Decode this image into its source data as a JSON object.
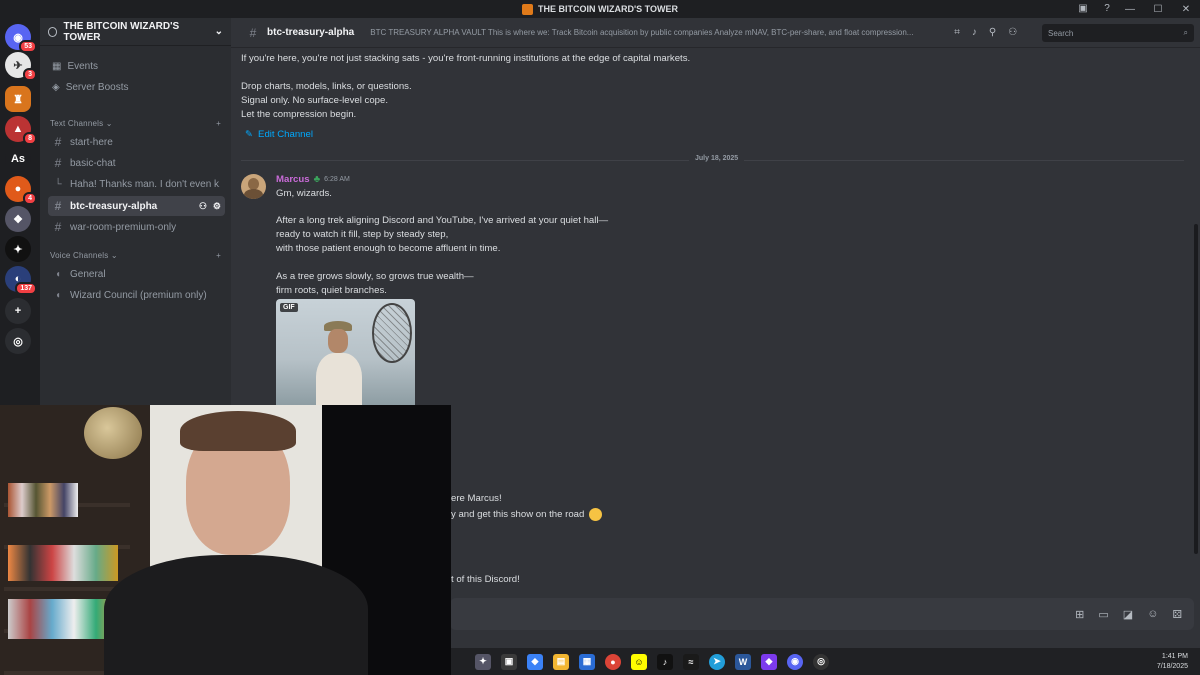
{
  "window": {
    "title": "THE BITCOIN WIZARD'S TOWER",
    "controls": [
      "—",
      "☐",
      "✕"
    ]
  },
  "servers": {
    "badges": [
      "53",
      "3",
      "8",
      "4",
      "137"
    ],
    "initials": "As"
  },
  "sidebar": {
    "server_name": "THE BITCOIN WIZARD'S TOWER",
    "events": "Events",
    "boosts": "Server Boosts",
    "text_category": "Text Channels",
    "voice_category": "Voice Channels",
    "text_channels": [
      {
        "label": "start-here"
      },
      {
        "label": "basic-chat"
      },
      {
        "label": "Haha! Thanks man. I don't even k..."
      },
      {
        "label": "btc-treasury-alpha"
      },
      {
        "label": "war-room-premium-only"
      }
    ],
    "voice_channels": [
      {
        "label": "General"
      },
      {
        "label": "Wizard Council (premium only)"
      }
    ]
  },
  "header": {
    "channel": "btc-treasury-alpha",
    "topic": "BTC TREASURY ALPHA VAULT This is where we: Track Bitcoin acquisition by public companies Analyze mNAV, BTC-per-share, and float compression...",
    "search_placeholder": "Search"
  },
  "intro": {
    "line1": "If you're here, you're not just stacking sats - you're front-running institutions at the edge of capital markets.",
    "line2": "Drop charts, models, links, or questions.",
    "line3": "Signal only. No surface-level cope.",
    "line4": "Let the compression begin.",
    "edit_label": "Edit Channel"
  },
  "date_divider": "July 18, 2025",
  "message": {
    "author": "Marcus",
    "time": "6:28 AM",
    "lines": [
      "Gm, wizards.",
      "After a long trek aligning Discord and YouTube, I've arrived at your quiet hall—",
      "ready to watch it fill, step by steady step,",
      "with those patient enough to become affluent in time.",
      "As a tree grows slowly, so grows true wealth—",
      "firm roots, quiet branches."
    ],
    "gif_tag": "GIF"
  },
  "partial_replies": {
    "r1": "ere Marcus!",
    "r2": "y and get this show on the road",
    "r3": "t of this Discord!"
  },
  "taskbar": {
    "time": "1:41 PM",
    "date": "7/18/2025"
  },
  "colors": {
    "accent": "#00a8fc",
    "author": "#c96bd8",
    "badge": "#f23f43"
  }
}
